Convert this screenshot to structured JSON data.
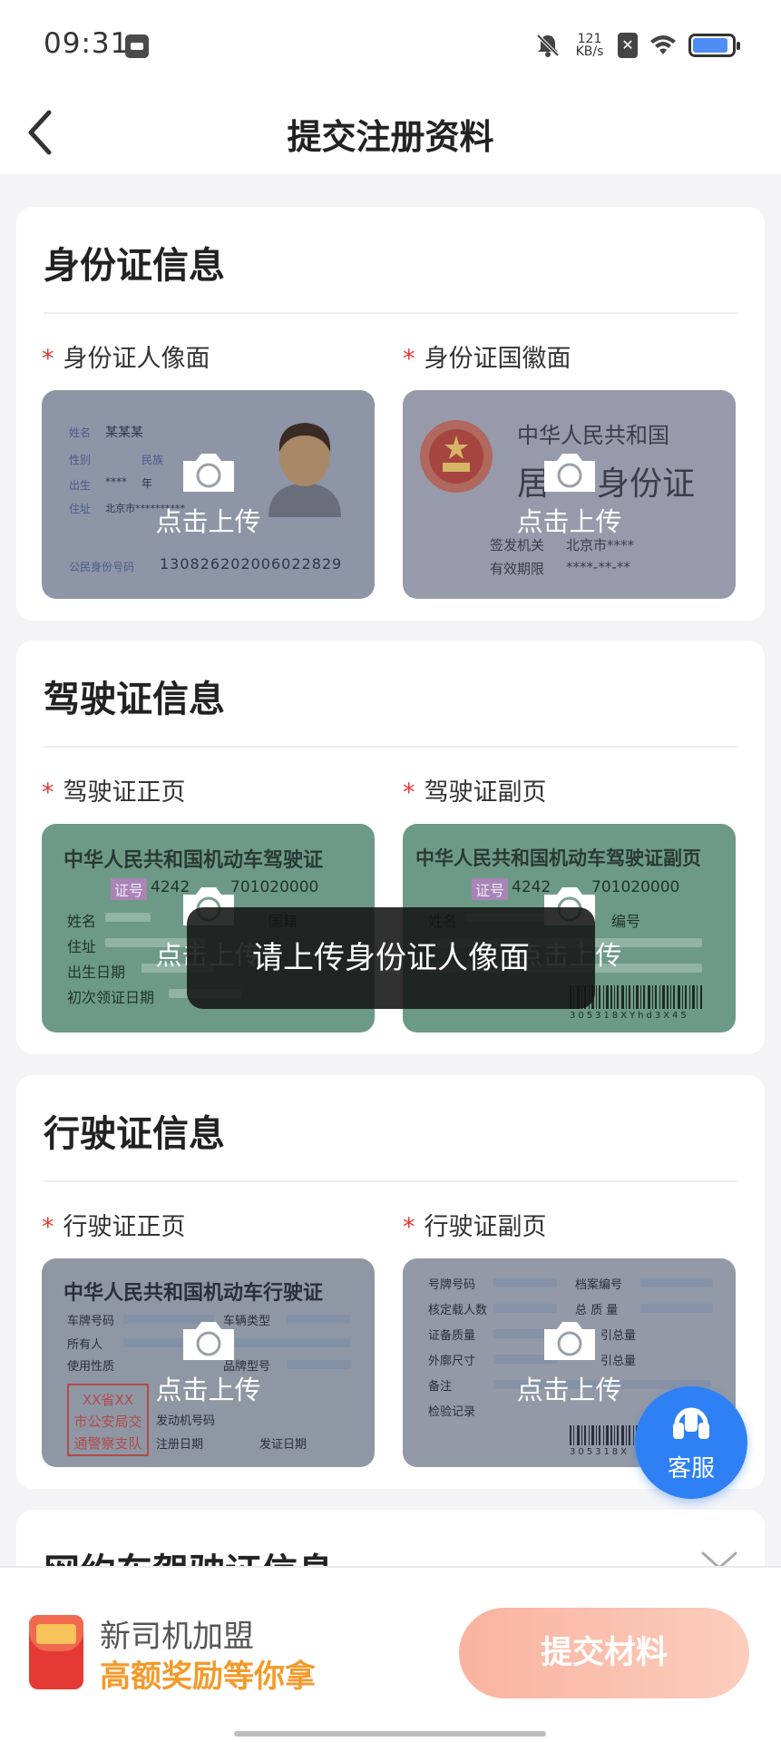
{
  "status_bar": {
    "time": "09:31",
    "net_speed_value": "121",
    "net_speed_unit": "KB/s",
    "sim_label": "✕",
    "battery_level": 0.9
  },
  "nav": {
    "title": "提交注册资料"
  },
  "sections": [
    {
      "title": "身份证信息",
      "items": [
        {
          "label": "身份证人像面",
          "required_mark": "*",
          "upload_text": "点击上传",
          "sample": {
            "l1": "姓名",
            "v1": "某某某",
            "l2": "性别",
            "l3": "民族",
            "l4": "出生",
            "v4": "****",
            "l4b": "年",
            "l5": "住址",
            "v5": "北京市**********",
            "l6": "公民身份号码",
            "v6": "130826202006022829"
          }
        },
        {
          "label": "身份证国徽面",
          "required_mark": "*",
          "upload_text": "点击上传",
          "sample": {
            "t1": "中华人民共和国",
            "t2a": "居",
            "t2b": "身份证",
            "l3": "签发机关",
            "v3": "北京市****",
            "l4": "有效期限",
            "v4": "****-**-**"
          }
        }
      ]
    },
    {
      "title": "驾驶证信息",
      "items": [
        {
          "label": "驾驶证正页",
          "required_mark": "*",
          "upload_text": "点击上传",
          "sample": {
            "t1": "中华人民共和国机动车驾驶证",
            "badge": "证号",
            "num": "4242",
            "num2": "701020000",
            "l1": "姓名",
            "l2": "住址",
            "l3": "出生日期",
            "l4": "初次领证日期",
            "l5": "国籍"
          }
        },
        {
          "label": "驾驶证副页",
          "required_mark": "*",
          "upload_text": "点击上传",
          "sample": {
            "t1": "中华人民共和国机动车驾驶证副页",
            "badge": "证号",
            "num": "4242",
            "num2": "701020000",
            "l1": "姓名",
            "l2": "编号",
            "barcode": "305318XYhd3X45"
          }
        }
      ]
    },
    {
      "title": "行驶证信息",
      "items": [
        {
          "label": "行驶证正页",
          "required_mark": "*",
          "upload_text": "点击上传",
          "sample": {
            "t1": "中华人民共和国机动车行驶证",
            "l1": "车牌号码",
            "l2": "车辆类型",
            "l3": "所有人",
            "l4": "使用性质",
            "l5": "品牌型号",
            "l6": "发动机号码",
            "l7": "注册日期",
            "l8": "发证日期",
            "stamp1": "XX省XX",
            "stamp2": "市公安局交",
            "stamp3": "通警察支队"
          }
        },
        {
          "label": "行驶证副页",
          "required_mark": "*",
          "upload_text": "点击上传",
          "sample": {
            "l1": "号牌号码",
            "l2": "档案编号",
            "l3": "核定载人数",
            "l4": "总 质 量",
            "l5": "证备质量",
            "l6": "引总量",
            "l7": "外廓尺寸",
            "l8": "引总量",
            "l9": "备注",
            "l10": "检验记录",
            "barcode": "305318X"
          }
        }
      ]
    }
  ],
  "partial_section": {
    "title": "网约车驾驶证信息"
  },
  "toast": {
    "message": "请上传身份证人像面"
  },
  "service": {
    "label": "客服"
  },
  "bottom_bar": {
    "promo_line1": "新司机加盟",
    "promo_line2": "高额奖励等你拿",
    "submit_label": "提交材料"
  }
}
